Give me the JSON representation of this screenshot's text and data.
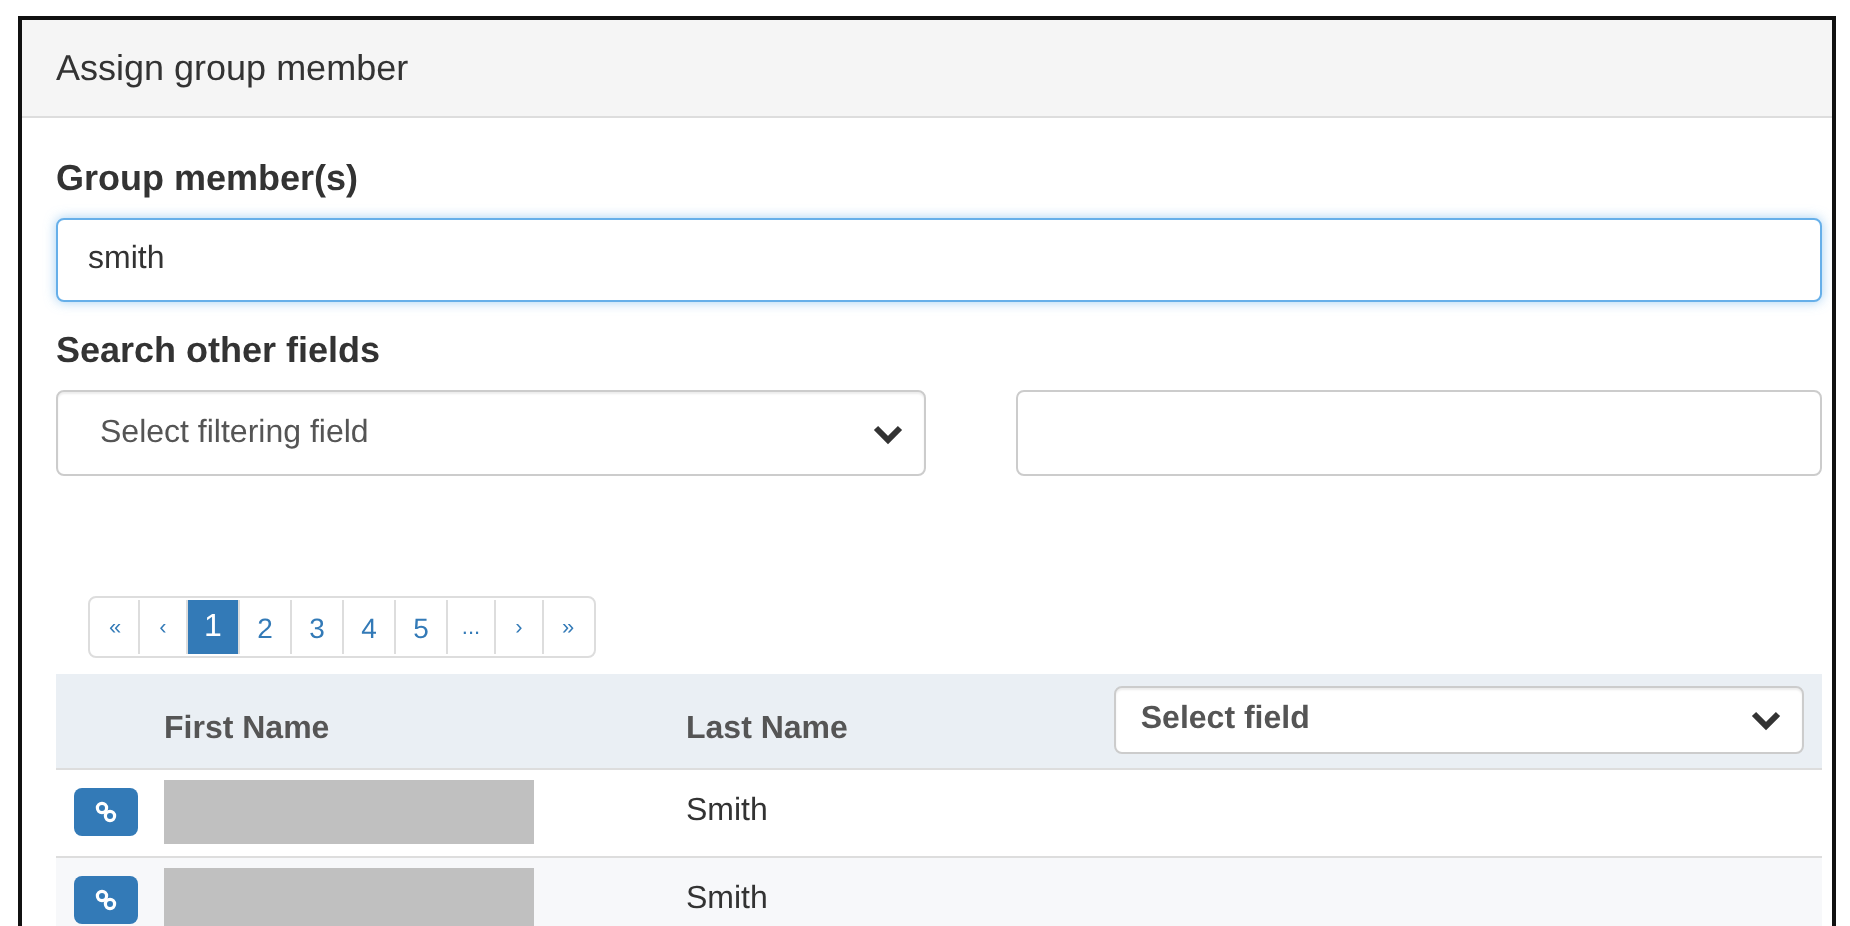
{
  "panel": {
    "title": "Assign group member"
  },
  "members_field": {
    "label": "Group member(s)",
    "value": "smith"
  },
  "search_other": {
    "label": "Search other fields",
    "filter_select": {
      "placeholder": "Select filtering field"
    }
  },
  "pagination": [
    {
      "label": "«",
      "selected": false
    },
    {
      "label": "‹",
      "selected": false
    },
    {
      "label": "1",
      "selected": true
    },
    {
      "label": "2",
      "selected": false
    },
    {
      "label": "3",
      "selected": false
    },
    {
      "label": "4",
      "selected": false
    },
    {
      "label": "5",
      "selected": false
    },
    {
      "label": "...",
      "selected": false
    },
    {
      "label": "›",
      "selected": false
    },
    {
      "label": "»",
      "selected": false
    }
  ],
  "table": {
    "columns": [
      "First Name",
      "Last Name"
    ],
    "field_select": {
      "placeholder": "Select field"
    },
    "rows": [
      {
        "first_name": {
          "kind": "redacted"
        },
        "last_name": "Smith"
      },
      {
        "first_name": {
          "kind": "redacted"
        },
        "last_name": "Smith"
      }
    ]
  }
}
